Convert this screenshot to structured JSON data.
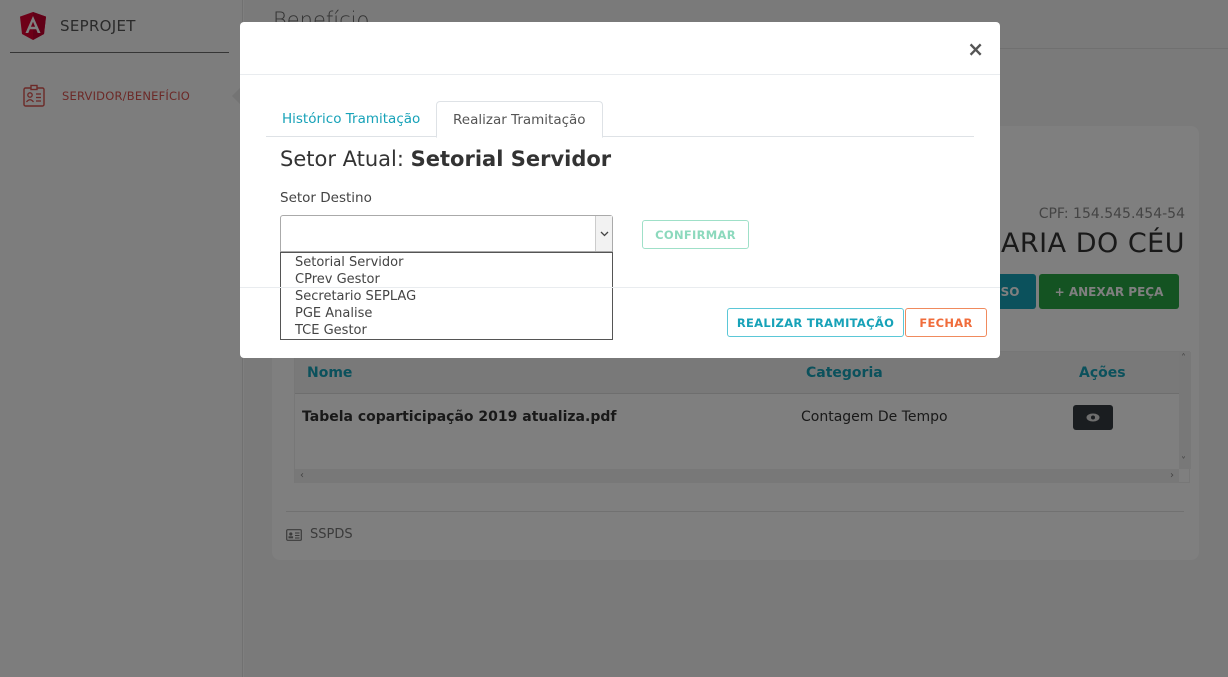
{
  "app": {
    "brand": "SEPROJET"
  },
  "sidebar": {
    "items": [
      {
        "label": "SERVIDOR/BENEFÍCIO"
      }
    ]
  },
  "page": {
    "title": "Benefício",
    "cpf": "CPF: 154.545.454-54",
    "name_partial": "ARIA DO CÉU",
    "buttons": {
      "teal_partial": "SO",
      "anexar": "+ ANEXAR PEÇA"
    },
    "table": {
      "headers": [
        "Nome",
        "Categoria",
        "Ações"
      ],
      "rows": [
        {
          "nome": "Tabela coparticipação 2019 atualiza.pdf",
          "categoria": "Contagem De Tempo"
        }
      ]
    },
    "footer": {
      "label": "SSPDS"
    }
  },
  "modal": {
    "close": "×",
    "tabs": [
      {
        "label": "Histórico Tramitação"
      },
      {
        "label": "Realizar Tramitação"
      }
    ],
    "setor_atual_prefix": "Setor Atual:",
    "setor_atual_value": "Setorial Servidor",
    "setor_destino_label": "Setor Destino",
    "select": {
      "value": "",
      "options": [
        "Setorial Servidor",
        "CPrev Gestor",
        "Secretario SEPLAG",
        "PGE Analise",
        "TCE Gestor"
      ]
    },
    "confirm_label": "CONFIRMAR",
    "footer_buttons": {
      "realizar": "REALIZAR TRAMITAÇÃO",
      "fechar": "FECHAR"
    }
  },
  "colors": {
    "accent": "#17a2b8",
    "success": "#28a745",
    "danger": "#d9534f",
    "warning": "#f06c3b",
    "overlay": "rgba(0,0,0,0.5)"
  }
}
